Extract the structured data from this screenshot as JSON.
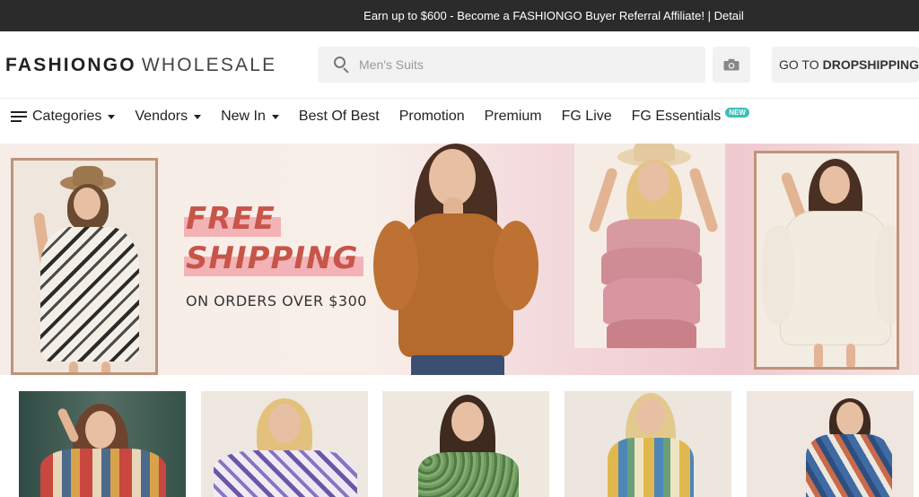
{
  "announcement": {
    "text": "Earn up to $600 - Become a FASHIONGO Buyer Referral Affiliate! | Detail"
  },
  "header": {
    "logo_brand": "FASHIONGO",
    "logo_sub": "WHOLESALE",
    "search_placeholder": "Men's Suits",
    "camera_icon": "camera-icon",
    "dropship_prefix": "GO TO",
    "dropship_bold": "DROPSHIPPING"
  },
  "nav": {
    "items": [
      {
        "label": "Categories",
        "dropdown": true
      },
      {
        "label": "Vendors",
        "dropdown": true
      },
      {
        "label": "New In",
        "dropdown": true
      },
      {
        "label": "Best Of Best",
        "dropdown": false
      },
      {
        "label": "Promotion",
        "dropdown": false
      },
      {
        "label": "Premium",
        "dropdown": false
      },
      {
        "label": "FG Live",
        "dropdown": false
      },
      {
        "label": "FG Essentials",
        "dropdown": false,
        "badge": "NEW"
      }
    ]
  },
  "banner": {
    "line1": "FREE",
    "line2": "SHIPPING",
    "subline": "ON ORDERS OVER $300",
    "accent_color": "#c8554a",
    "highlight_color": "#f3b3b6"
  },
  "products": {
    "count": 5
  }
}
